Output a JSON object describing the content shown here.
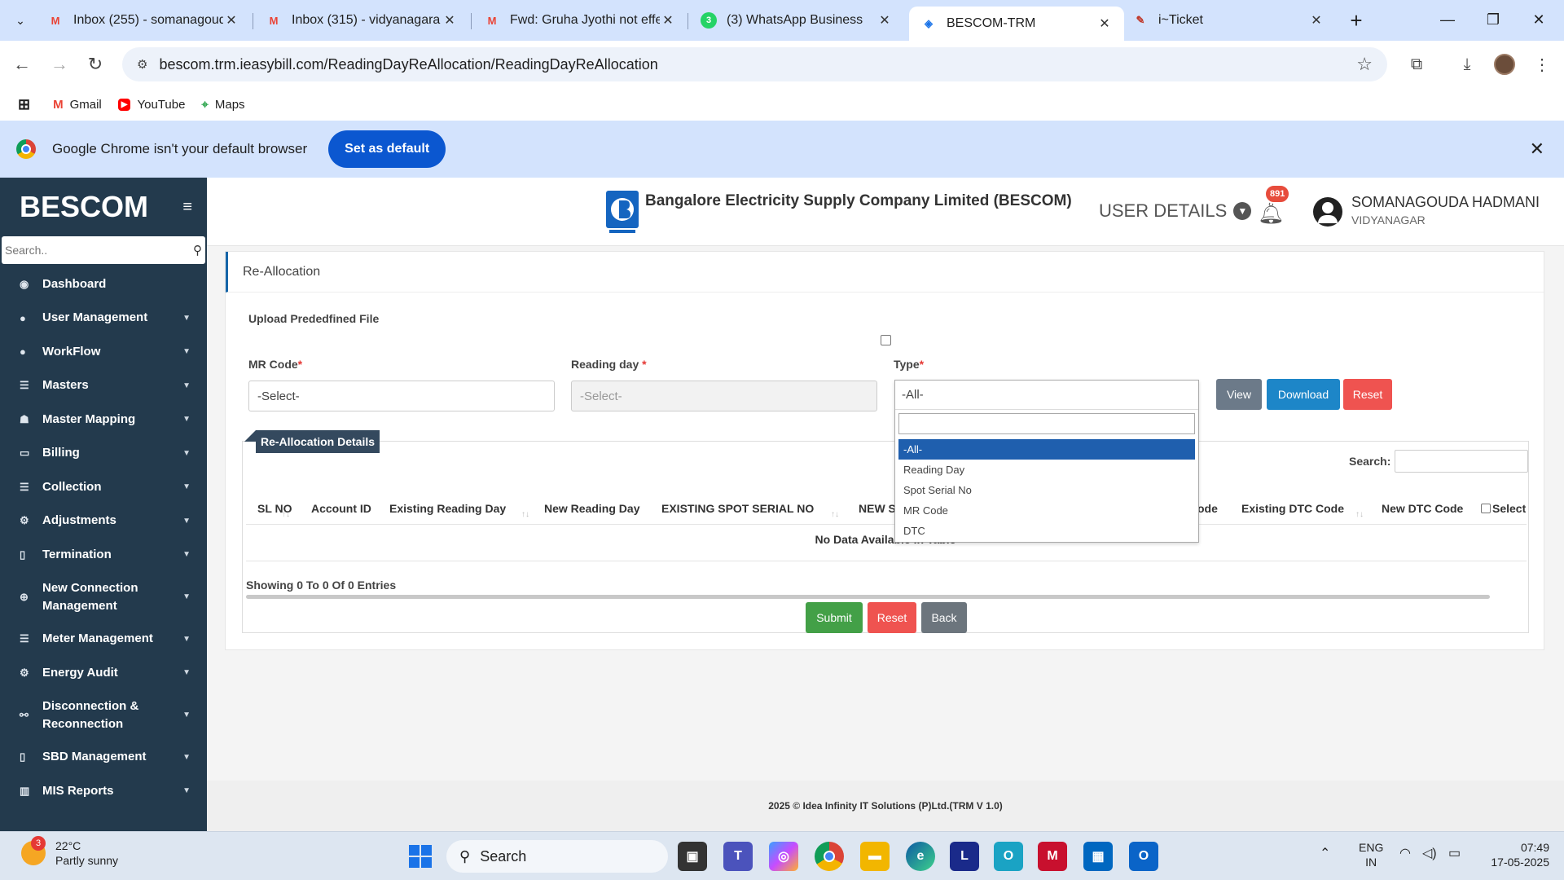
{
  "browser": {
    "tabs": [
      {
        "title": "Inbox (255) - somanagoud",
        "icon": "gmail-icon"
      },
      {
        "title": "Inbox (315) - vidyanagara",
        "icon": "gmail-icon"
      },
      {
        "title": "Fwd: Gruha Jyothi not effe",
        "icon": "gmail-icon"
      },
      {
        "title": "(3) WhatsApp Business",
        "icon": "whatsapp-icon"
      },
      {
        "title": "BESCOM-TRM",
        "icon": "bescom-icon"
      },
      {
        "title": "i~Ticket",
        "icon": "ticket-icon"
      }
    ],
    "url": "bescom.trm.ieasybill.com/ReadingDayReAllocation/ReadingDayReAllocation",
    "bookmarks": [
      "Gmail",
      "YouTube",
      "Maps"
    ],
    "infobar_text": "Google Chrome isn't your default browser",
    "infobar_button": "Set as default"
  },
  "sidebar": {
    "brand": "BESCOM",
    "search_placeholder": "Search..",
    "items": [
      {
        "label": "Dashboard",
        "icon": "dashboard-icon",
        "chevron": ""
      },
      {
        "label": "User Management",
        "icon": "user-icon",
        "chevron": "⌄"
      },
      {
        "label": "WorkFlow",
        "icon": "workflow-icon",
        "chevron": "⌄"
      },
      {
        "label": "Masters",
        "icon": "masters-icon",
        "chevron": "⌄"
      },
      {
        "label": "Master Mapping",
        "icon": "mapping-icon",
        "chevron": "⌄"
      },
      {
        "label": "Billing",
        "icon": "billing-icon",
        "chevron": "⌄"
      },
      {
        "label": "Collection",
        "icon": "collection-icon",
        "chevron": "⌄"
      },
      {
        "label": "Adjustments",
        "icon": "adjustments-icon",
        "chevron": "⌄"
      },
      {
        "label": "Termination",
        "icon": "termination-icon",
        "chevron": "⌄"
      },
      {
        "label": "New Connection Management",
        "icon": "new-connection-icon",
        "chevron": "⌄"
      },
      {
        "label": "Meter Management",
        "icon": "meter-icon",
        "chevron": "⌄"
      },
      {
        "label": "Energy Audit",
        "icon": "audit-icon",
        "chevron": "⌄"
      },
      {
        "label": "Disconnection & Reconnection",
        "icon": "disconnection-icon",
        "chevron": "⌄"
      },
      {
        "label": "SBD Management",
        "icon": "sbd-icon",
        "chevron": "⌄"
      },
      {
        "label": "MIS Reports",
        "icon": "reports-icon",
        "chevron": "⌄"
      }
    ]
  },
  "header": {
    "company": "Bangalore Electricity Supply Company Limited (BESCOM)",
    "user_details_label": "USER DETAILS",
    "notification_count": "891",
    "user_name": "SOMANAGOUDA HADMANI",
    "user_location": "VIDYANAGAR"
  },
  "page": {
    "title": "Re-Allocation",
    "upload_label": "Upload Prededfined File",
    "mr_code_label": "MR Code",
    "mr_code_value": "-Select-",
    "reading_day_label": "Reading day ",
    "reading_day_value": "-Select-",
    "type_label": "Type",
    "type_value": "-All-",
    "required_mark": "*",
    "view_button": "View",
    "download_button": "Download",
    "reset_button": "Reset",
    "details_title": "Re-Allocation Details",
    "search_label": "Search:",
    "columns": [
      "SL NO",
      "Account ID",
      "Existing Reading Day",
      "New Reading Day",
      "EXISTING SPOT SERIAL NO",
      "NEW S",
      "ode",
      "Existing DTC Code",
      "New DTC Code",
      "Select"
    ],
    "no_data": "No Data Available In Table",
    "showing": "Showing 0 To 0 Of 0 Entries",
    "submit_button": "Submit",
    "reset2_button": "Reset",
    "back_button": "Back"
  },
  "type_dropdown": {
    "options": [
      "-All-",
      "Reading Day",
      "Spot Serial No",
      "MR Code",
      "DTC"
    ],
    "selected": "-All-"
  },
  "footer": {
    "text": "2025 © Idea Infinity IT Solutions (P)Ltd.(TRM V 1.0)"
  },
  "taskbar": {
    "weather_temp": "22°C",
    "weather_desc": "Partly sunny",
    "weather_badge": "3",
    "search_label": "Search",
    "lang": "ENG",
    "region": "IN",
    "time": "07:49",
    "date": "17-05-2025"
  }
}
